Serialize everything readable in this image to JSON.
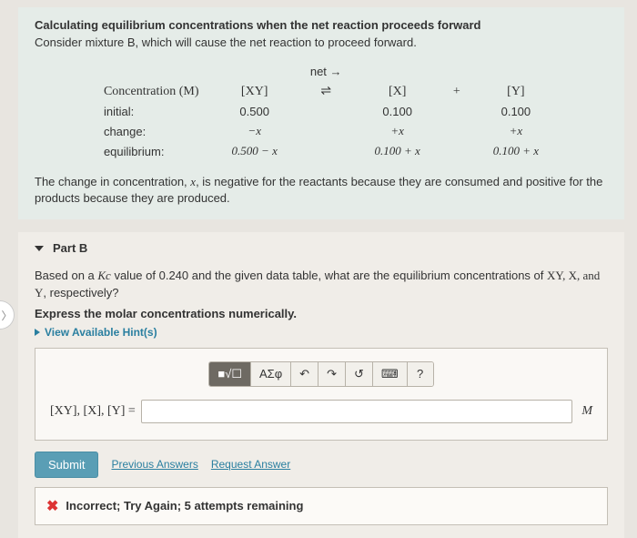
{
  "info": {
    "title": "Calculating equilibrium concentrations when the net reaction proceeds forward",
    "subtitle": "Consider mixture B, which will cause the net reaction to proceed forward.",
    "net_label": "net →",
    "headers": {
      "conc": "Concentration (M)",
      "xy": "[XY]",
      "eq": "⇌",
      "x": "[X]",
      "plus": "+",
      "y": "[Y]"
    },
    "rows": {
      "initial": {
        "label": "initial:",
        "xy": "0.500",
        "x": "0.100",
        "y": "0.100"
      },
      "change": {
        "label": "change:",
        "xy": "−x",
        "x": "+x",
        "y": "+x"
      },
      "equil": {
        "label": "equilibrium:",
        "xy": "0.500 − x",
        "x": "0.100 + x",
        "y": "0.100 + x"
      }
    },
    "footnote_a": "The change in concentration, ",
    "footnote_var": "x",
    "footnote_b": ", is negative for the reactants because they are consumed and positive for the products because they are produced."
  },
  "partB": {
    "title": "Part B",
    "question_a": "Based on a ",
    "question_kc": "Kc",
    "question_b": " value of 0.240 and the given data table, what are the equilibrium concentrations of ",
    "question_vars": "XY, X, and Y",
    "question_c": ", respectively?",
    "instruction": "Express the molar concentrations numerically.",
    "hint_label": "View Available Hint(s)",
    "toolbar": {
      "templates": "■√☐",
      "symbols": "ΑΣφ",
      "undo": "↶",
      "redo": "↷",
      "reset": "↺",
      "keyboard": "⌨",
      "help": "?"
    },
    "answer_label": "[XY], [X], [Y] =",
    "answer_value": "",
    "unit": "M",
    "submit": "Submit",
    "prev_answers": "Previous Answers",
    "request_answer": "Request Answer",
    "feedback_icon": "✖",
    "feedback_text": "Incorrect; Try Again; 5 attempts remaining"
  },
  "side_nav": "〉"
}
